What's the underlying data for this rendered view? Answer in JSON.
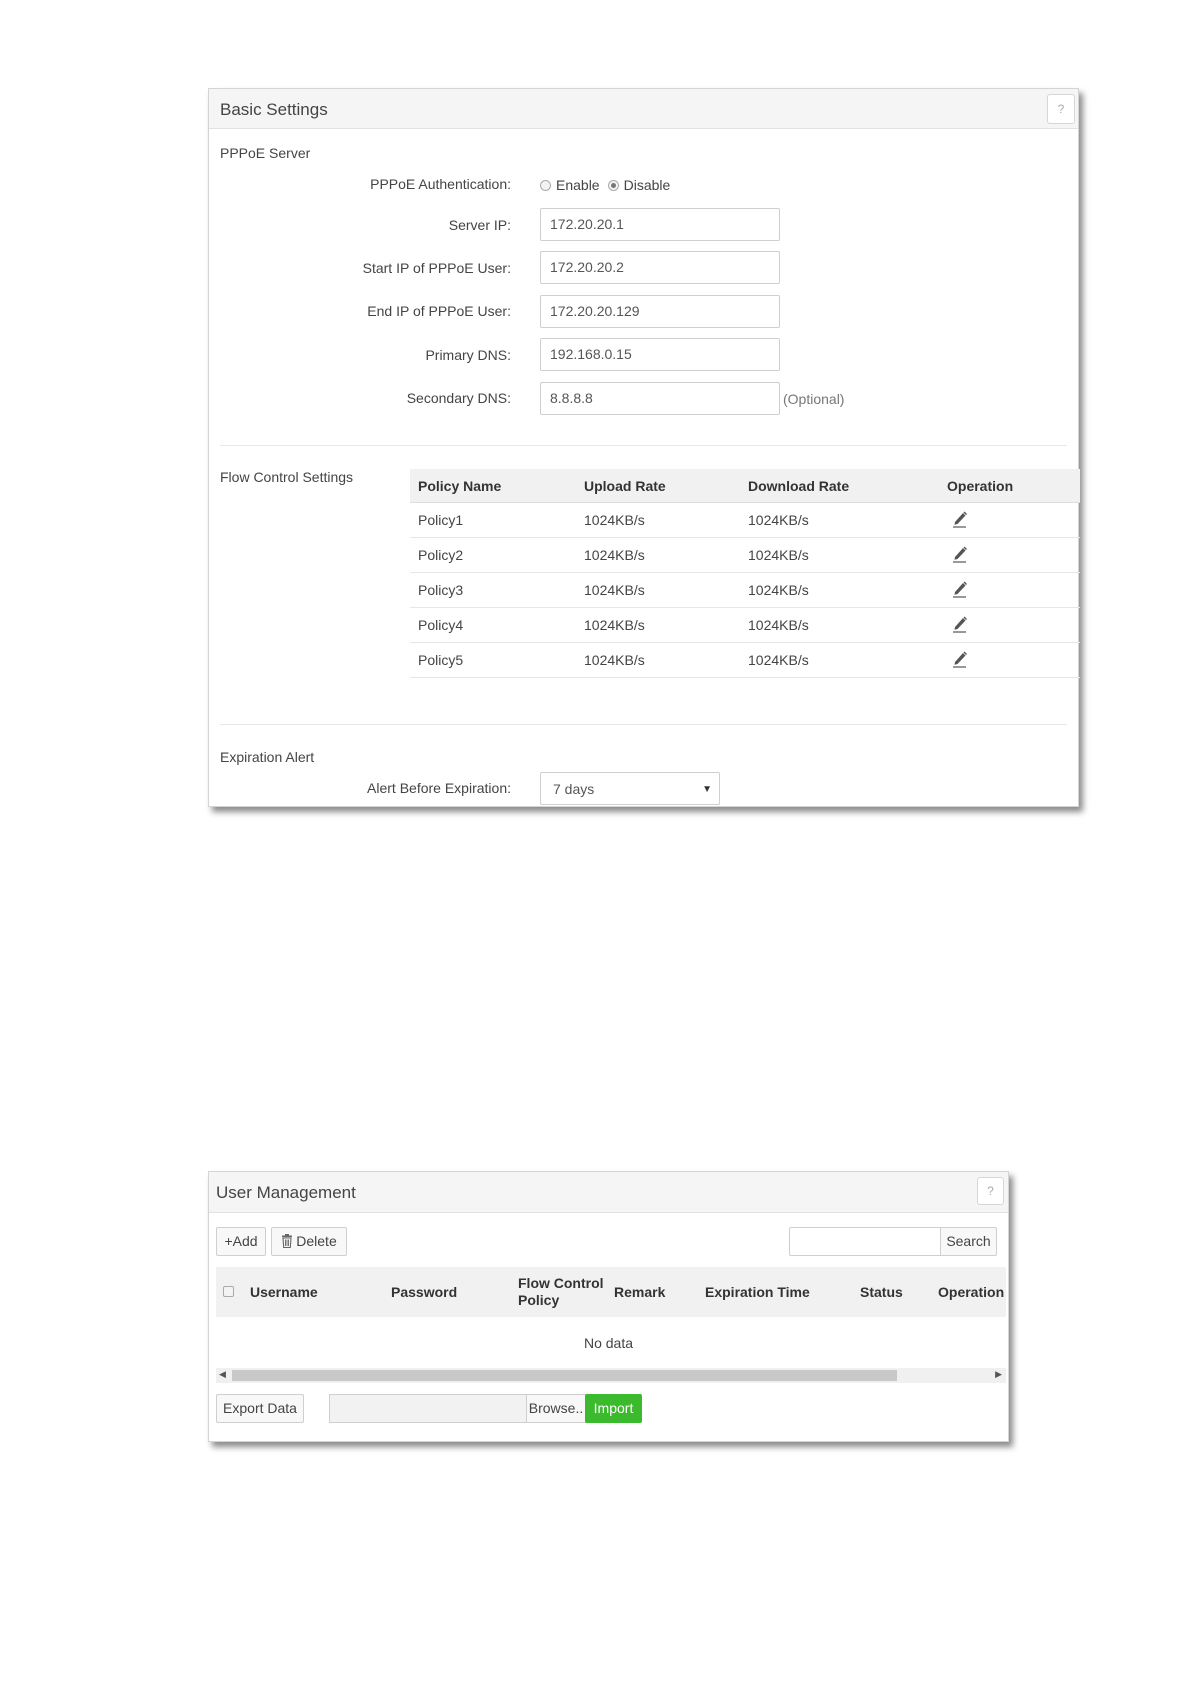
{
  "basic_settings": {
    "title": "Basic Settings",
    "help_label": "?",
    "pppoe_server": {
      "section_label": "PPPoE Server",
      "auth_label": "PPPoE Authentication:",
      "auth_options": [
        "Enable",
        "Disable"
      ],
      "auth_selected": "Disable",
      "server_ip_label": "Server IP:",
      "server_ip": "172.20.20.1",
      "start_ip_label": "Start IP of PPPoE User:",
      "start_ip": "172.20.20.2",
      "end_ip_label": "End IP of PPPoE User:",
      "end_ip": "172.20.20.129",
      "primary_dns_label": "Primary DNS:",
      "primary_dns": "192.168.0.15",
      "secondary_dns_label": "Secondary DNS:",
      "secondary_dns": "8.8.8.8",
      "optional_note": "(Optional)"
    },
    "flow_control": {
      "section_label": "Flow Control Settings",
      "columns": [
        "Policy Name",
        "Upload Rate",
        "Download Rate",
        "Operation"
      ],
      "rows": [
        {
          "name": "Policy1",
          "upload": "1024KB/s",
          "download": "1024KB/s"
        },
        {
          "name": "Policy2",
          "upload": "1024KB/s",
          "download": "1024KB/s"
        },
        {
          "name": "Policy3",
          "upload": "1024KB/s",
          "download": "1024KB/s"
        },
        {
          "name": "Policy4",
          "upload": "1024KB/s",
          "download": "1024KB/s"
        },
        {
          "name": "Policy5",
          "upload": "1024KB/s",
          "download": "1024KB/s"
        }
      ],
      "operation_icon": "edit-pencil-icon"
    },
    "expiration_alert": {
      "section_label": "Expiration Alert",
      "alert_label": "Alert Before Expiration:",
      "alert_value": "7 days"
    }
  },
  "user_management": {
    "title": "User Management",
    "help_label": "?",
    "add_label": "+Add",
    "delete_label": "Delete",
    "search_value": "",
    "search_label": "Search",
    "columns": [
      "Username",
      "Password",
      "Flow Control Policy",
      "Remark",
      "Expiration Time",
      "Status",
      "Operation"
    ],
    "no_data": "No data",
    "export_label": "Export Data",
    "browse_label": "Browse..",
    "import_label": "Import",
    "import_color": "#3cba2d"
  }
}
